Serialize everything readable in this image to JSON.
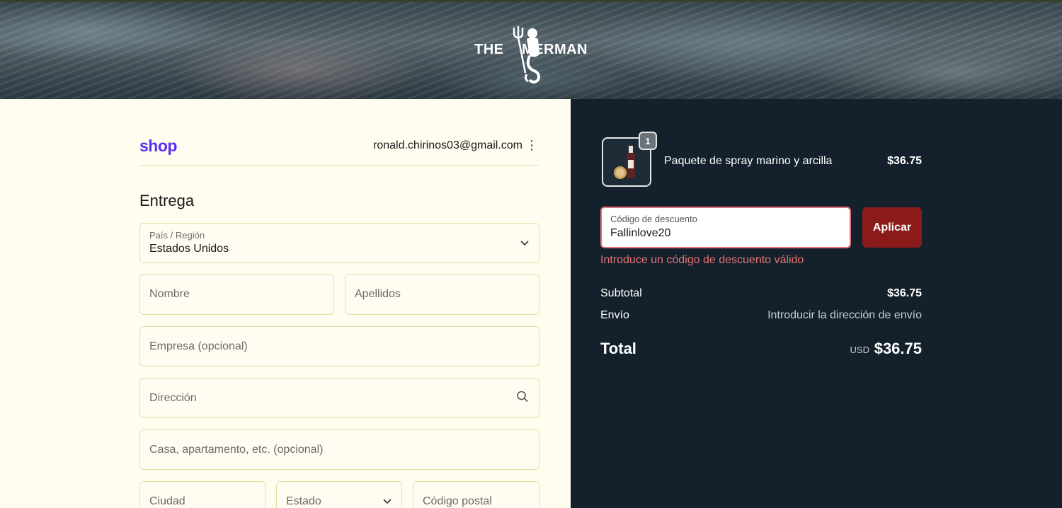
{
  "header": {
    "brand_left": "THE",
    "brand_right": "MERMAN"
  },
  "account": {
    "shop_logo": "shop",
    "email": "ronald.chirinos03@gmail.com",
    "menu_icon": "⋮"
  },
  "delivery": {
    "title": "Entrega",
    "country": {
      "label": "País / Región",
      "value": "Estados Unidos"
    },
    "first_name_placeholder": "Nombre",
    "last_name_placeholder": "Apellidos",
    "company_placeholder": "Empresa (opcional)",
    "address_placeholder": "Dirección",
    "apartment_placeholder": "Casa, apartamento, etc. (opcional)",
    "city_placeholder": "Ciudad",
    "state_placeholder": "Estado",
    "zip_placeholder": "Código postal"
  },
  "summary": {
    "item": {
      "quantity": "1",
      "name": "Paquete de spray marino y arcilla",
      "price": "$36.75"
    },
    "discount": {
      "label": "Código de descuento",
      "value": "Fallinlove20",
      "apply_label": "Aplicar",
      "error": "Introduce un código de descuento válido"
    },
    "subtotal_label": "Subtotal",
    "subtotal_value": "$36.75",
    "shipping_label": "Envío",
    "shipping_value": "Introducir la dirección de envío",
    "total_label": "Total",
    "total_currency": "USD",
    "total_value": "$36.75"
  },
  "colors": {
    "shop_brand": "#5a31f4",
    "summary_bg": "#14212c",
    "apply_button": "#8b1a1a",
    "error_text": "#e57373",
    "page_bg": "#fffcf0"
  }
}
